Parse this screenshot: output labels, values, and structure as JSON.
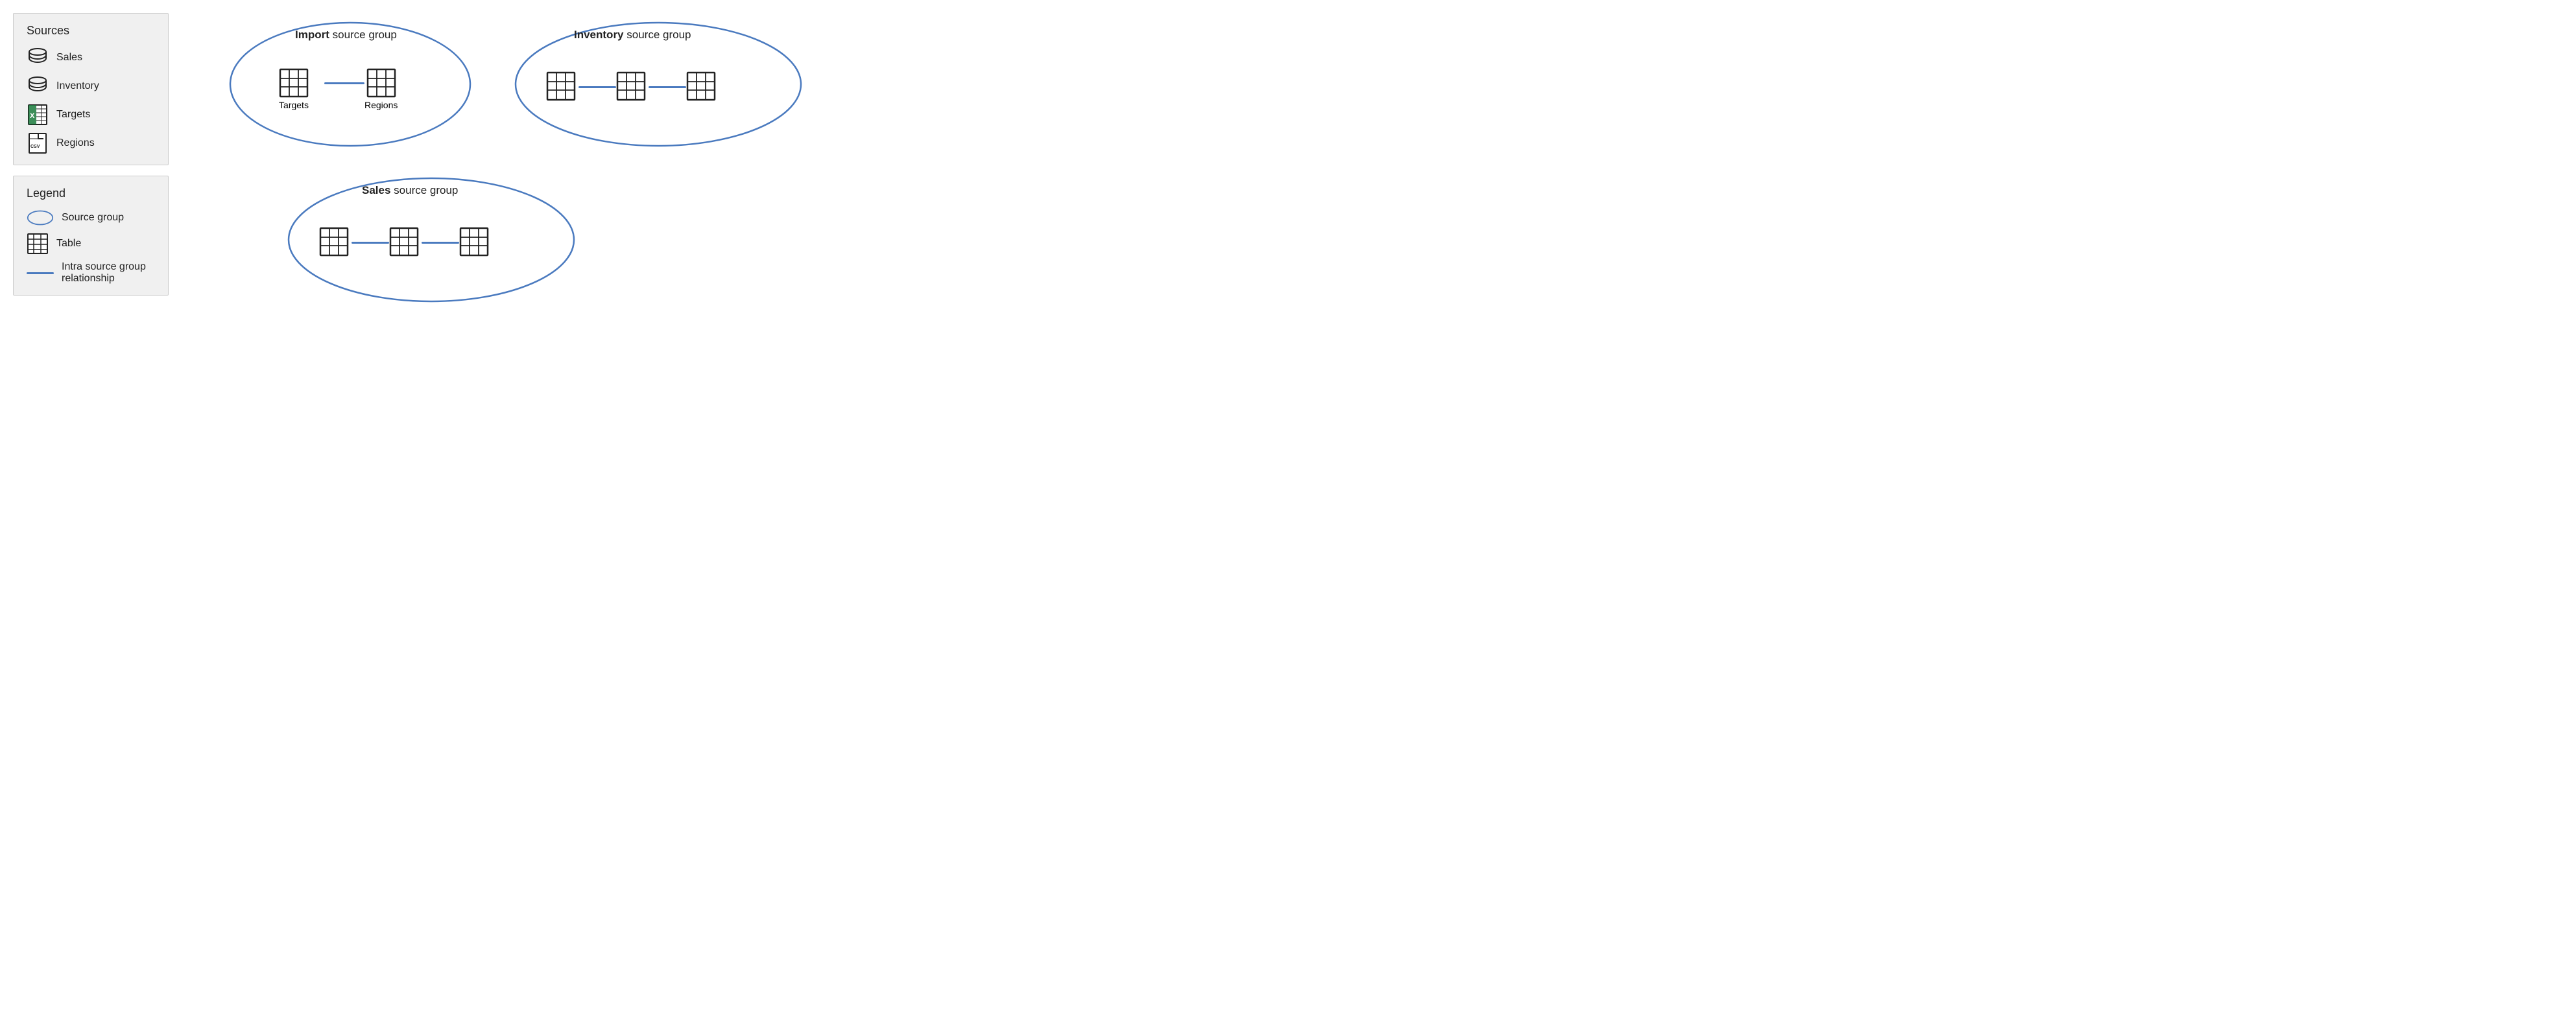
{
  "sources_panel": {
    "title": "Sources",
    "items": [
      {
        "id": "sales",
        "label": "Sales",
        "icon": "database"
      },
      {
        "id": "inventory",
        "label": "Inventory",
        "icon": "database"
      },
      {
        "id": "targets",
        "label": "Targets",
        "icon": "excel"
      },
      {
        "id": "regions",
        "label": "Regions",
        "icon": "csv"
      }
    ]
  },
  "legend_panel": {
    "title": "Legend",
    "items": [
      {
        "id": "source-group",
        "label": "Source group",
        "icon": "ellipse"
      },
      {
        "id": "table",
        "label": "Table",
        "icon": "table"
      },
      {
        "id": "relationship",
        "label": "Intra source group relationship",
        "icon": "line"
      }
    ]
  },
  "diagram": {
    "groups": [
      {
        "id": "import-group",
        "title_bold": "Import",
        "title_rest": " source group",
        "tables": [
          "Targets",
          "Regions"
        ]
      },
      {
        "id": "inventory-group",
        "title_bold": "Inventory",
        "title_rest": " source group",
        "tables": [
          "",
          "",
          ""
        ]
      },
      {
        "id": "sales-group",
        "title_bold": "Sales",
        "title_rest": " source group",
        "tables": [
          "",
          "",
          ""
        ]
      }
    ]
  },
  "colors": {
    "ellipse_stroke": "#4a7abf",
    "line_color": "#4a7abf",
    "panel_bg": "#f0f0f0"
  }
}
